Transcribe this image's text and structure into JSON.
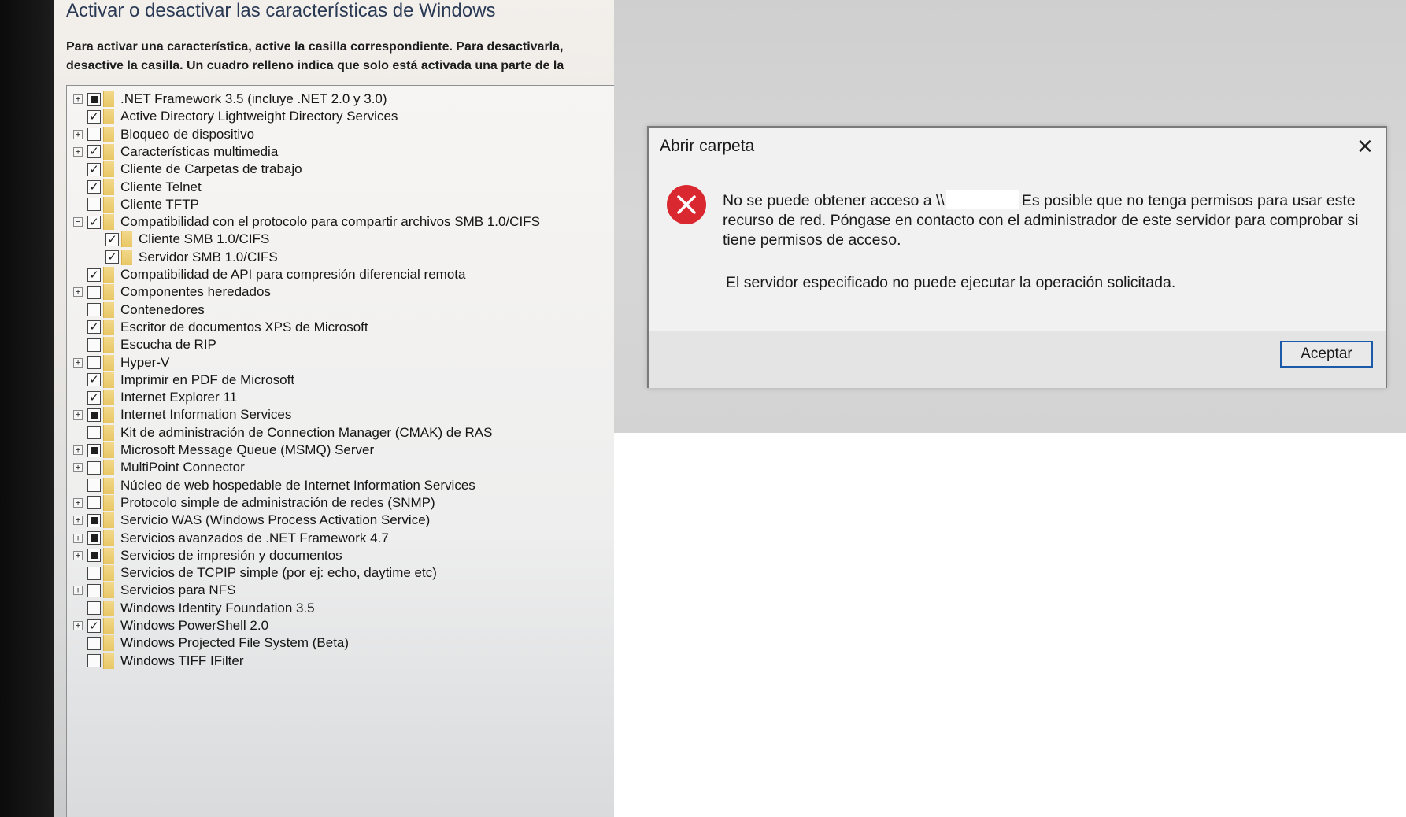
{
  "features_window": {
    "title": "Activar o desactivar las características de Windows",
    "description": "Para activar una característica, active la casilla correspondiente. Para desactivarla, desactive la casilla. Un cuadro relleno indica que solo está activada una parte de la característica.",
    "features": [
      {
        "label": ".NET Framework 3.5 (incluye .NET 2.0 y 3.0)",
        "state": "partial",
        "expandable": true,
        "level": 0
      },
      {
        "label": "Active Directory Lightweight Directory Services",
        "state": "checked",
        "expandable": false,
        "level": 0
      },
      {
        "label": "Bloqueo de dispositivo",
        "state": "unchecked",
        "expandable": true,
        "level": 0
      },
      {
        "label": "Características multimedia",
        "state": "checked",
        "expandable": true,
        "level": 0
      },
      {
        "label": "Cliente de Carpetas de trabajo",
        "state": "checked",
        "expandable": false,
        "level": 0
      },
      {
        "label": "Cliente Telnet",
        "state": "checked",
        "expandable": false,
        "level": 0
      },
      {
        "label": "Cliente TFTP",
        "state": "unchecked",
        "expandable": false,
        "level": 0
      },
      {
        "label": "Compatibilidad con el protocolo para compartir archivos SMB 1.0/CIFS",
        "state": "checked",
        "expandable": true,
        "expanded": true,
        "level": 0
      },
      {
        "label": "Cliente SMB 1.0/CIFS",
        "state": "checked",
        "expandable": false,
        "level": 1
      },
      {
        "label": "Servidor SMB 1.0/CIFS",
        "state": "checked",
        "expandable": false,
        "level": 1
      },
      {
        "label": "Compatibilidad de API para compresión diferencial remota",
        "state": "checked",
        "expandable": false,
        "level": 0
      },
      {
        "label": "Componentes heredados",
        "state": "unchecked",
        "expandable": true,
        "level": 0
      },
      {
        "label": "Contenedores",
        "state": "unchecked",
        "expandable": false,
        "level": 0
      },
      {
        "label": "Escritor de documentos XPS de Microsoft",
        "state": "checked",
        "expandable": false,
        "level": 0
      },
      {
        "label": "Escucha de RIP",
        "state": "unchecked",
        "expandable": false,
        "level": 0
      },
      {
        "label": "Hyper-V",
        "state": "unchecked",
        "expandable": true,
        "level": 0
      },
      {
        "label": "Imprimir en PDF de Microsoft",
        "state": "checked",
        "expandable": false,
        "level": 0
      },
      {
        "label": "Internet Explorer 11",
        "state": "checked",
        "expandable": false,
        "level": 0
      },
      {
        "label": "Internet Information Services",
        "state": "partial",
        "expandable": true,
        "level": 0
      },
      {
        "label": "Kit de administración de Connection Manager (CMAK) de RAS",
        "state": "unchecked",
        "expandable": false,
        "level": 0
      },
      {
        "label": "Microsoft Message Queue (MSMQ) Server",
        "state": "partial",
        "expandable": true,
        "level": 0
      },
      {
        "label": "MultiPoint Connector",
        "state": "unchecked",
        "expandable": true,
        "level": 0
      },
      {
        "label": "Núcleo de web hospedable de Internet Information Services",
        "state": "unchecked",
        "expandable": false,
        "level": 0
      },
      {
        "label": "Protocolo simple de administración de redes (SNMP)",
        "state": "unchecked",
        "expandable": true,
        "level": 0
      },
      {
        "label": "Servicio WAS (Windows Process Activation Service)",
        "state": "partial",
        "expandable": true,
        "level": 0
      },
      {
        "label": "Servicios avanzados de .NET Framework 4.7",
        "state": "partial",
        "expandable": true,
        "level": 0
      },
      {
        "label": "Servicios de impresión y documentos",
        "state": "partial",
        "expandable": true,
        "level": 0
      },
      {
        "label": "Servicios de TCPIP simple (por ej: echo, daytime etc)",
        "state": "unchecked",
        "expandable": false,
        "level": 0
      },
      {
        "label": "Servicios para NFS",
        "state": "unchecked",
        "expandable": true,
        "level": 0
      },
      {
        "label": "Windows Identity Foundation 3.5",
        "state": "unchecked",
        "expandable": false,
        "level": 0
      },
      {
        "label": "Windows PowerShell 2.0",
        "state": "checked",
        "expandable": true,
        "level": 0
      },
      {
        "label": "Windows Projected File System (Beta)",
        "state": "unchecked",
        "expandable": false,
        "level": 0
      },
      {
        "label": "Windows TIFF IFilter",
        "state": "unchecked",
        "expandable": false,
        "level": 0
      }
    ]
  },
  "dialog": {
    "title": "Abrir carpeta",
    "message_prefix": "No se puede obtener acceso a \\\\",
    "message_suffix": "Es posible que no tenga permisos para usar este recurso de red. Póngase en contacto con el administrador de este servidor para comprobar si tiene permisos de acceso.",
    "detail": "El servidor especificado no puede ejecutar la operación solicitada.",
    "ok_label": "Aceptar",
    "close_glyph": "✕",
    "icon": "error-icon",
    "error_color": "#d9282f",
    "button_border_color": "#1b5aa8"
  }
}
